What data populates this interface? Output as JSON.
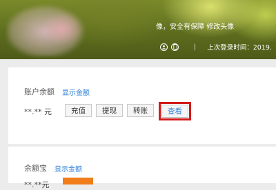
{
  "header": {
    "tagline_prefix": "像，安全有保障",
    "tagline_link": "修改头像",
    "separator": "|",
    "last_login": "上次登录时间：2019."
  },
  "balance": {
    "title": "账户余额",
    "show_amount": "显示金额",
    "amount": "**.** 元",
    "buttons": {
      "recharge": "充值",
      "withdraw": "提现",
      "transfer": "转账",
      "view": "查看"
    }
  },
  "yuebao": {
    "title": "余额宝",
    "show_amount": "显示金额",
    "amount": "**.**元"
  },
  "colors": {
    "link": "#2d7fd6",
    "highlight": "#d41a1a",
    "orange": "#f07d1a"
  }
}
